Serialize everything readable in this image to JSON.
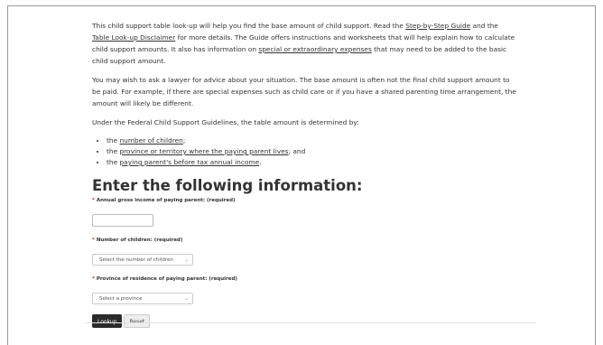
{
  "intro": {
    "p1": {
      "text1": "This child support table look-up will help you find the base amount of child support. Read the ",
      "link1": "Step-by-Step Guide",
      "text2": " and the ",
      "link2": "Table Look-up Disclaimer",
      "text3": " for more details. The Guide offers instructions and worksheets that will help explain how to calculate child support amounts. It also has information on ",
      "link3": "special or extraordinary expenses",
      "text4": " that may need to be added to the basic child support amount."
    },
    "p2": "You may wish to ask a lawyer for advice about your situation. The base amount is often not the final child support amount to be paid. For example, if there are special expenses such as child care or if you have a shared parenting time arrangement, the amount will likely be different.",
    "p3": "Under the Federal Child Support Guidelines, the table amount is determined by:",
    "bullets": [
      {
        "prefix": "the ",
        "link": "number of children",
        "suffix": ";"
      },
      {
        "prefix": "the ",
        "link": "province or territory where the paying parent lives",
        "suffix": "; and"
      },
      {
        "prefix": "the ",
        "link": "paying parent's before tax annual income",
        "suffix": "."
      }
    ]
  },
  "form": {
    "heading": "Enter the following information:",
    "required_marker": "*",
    "income": {
      "label": "Annual gross income of paying parent: (required)",
      "value": ""
    },
    "children": {
      "label": "Number of children: (required)",
      "selected": "Select the number of children"
    },
    "province": {
      "label": "Province of residence of paying parent: (required)",
      "selected": "Select a province"
    },
    "lookup_label": "Lookup",
    "reset_label": "Reset"
  },
  "icons": {
    "select_chevron": "chevron-down-icon"
  },
  "colors": {
    "text": "#333333",
    "primary_button": "#2b2b2b",
    "required_asterisk": "#c0392b"
  }
}
